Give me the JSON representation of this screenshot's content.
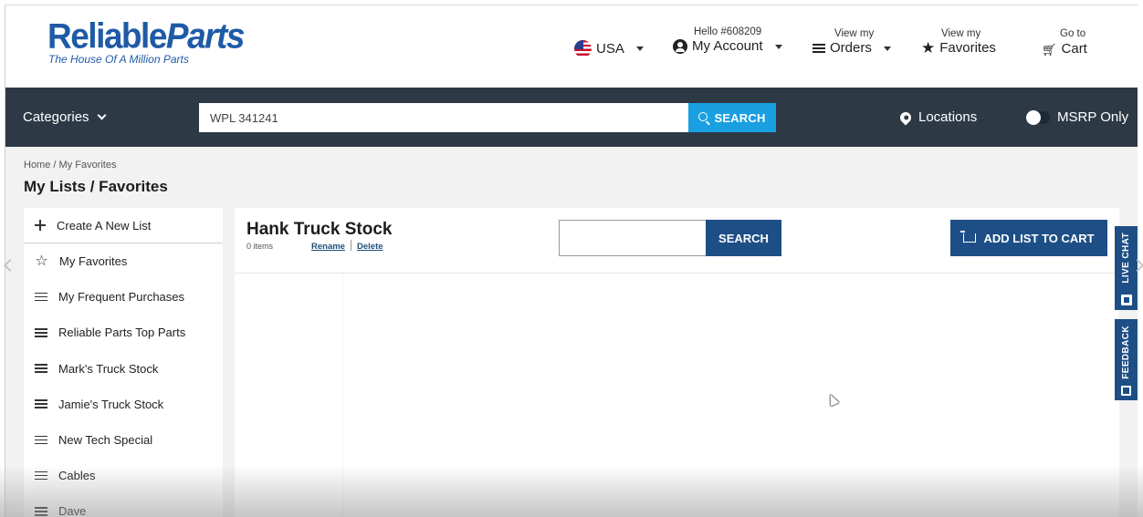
{
  "brand": {
    "name_a": "Reliable",
    "name_b": "Parts",
    "tagline": "The House Of A Million Parts",
    "color": "#1f5aa6"
  },
  "header": {
    "country": "USA",
    "account_greeting": "Hello #608209",
    "account_label": "My Account",
    "orders_small": "View my",
    "orders_label": "Orders",
    "favorites_small": "View my",
    "favorites_label": "Favorites",
    "cart_small": "Go to",
    "cart_label": "Cart"
  },
  "nav": {
    "categories_label": "Categories",
    "search_value": "WPL 341241",
    "search_button": "SEARCH",
    "locations_label": "Locations",
    "msrp_label": "MSRP Only",
    "msrp_enabled": false,
    "bg_color": "#2d3a45",
    "search_color": "#1a9fe0"
  },
  "page": {
    "breadcrumb": "Home / My Favorites",
    "title": "My Lists / Favorites"
  },
  "sidebar": {
    "create_label": "Create A New List",
    "favorites_label": "My Favorites",
    "items": [
      {
        "label": "My Frequent Purchases"
      },
      {
        "label": "Reliable Parts Top Parts"
      },
      {
        "label": "Mark's Truck Stock"
      },
      {
        "label": "Jamie's Truck Stock"
      },
      {
        "label": "New Tech Special"
      },
      {
        "label": "Cables"
      },
      {
        "label": "Dave"
      }
    ]
  },
  "list": {
    "title": "Hank Truck Stock",
    "item_count": "0 items",
    "rename_label": "Rename",
    "delete_label": "Delete",
    "search_placeholder": "",
    "search_button": "SEARCH",
    "add_to_cart_label": "ADD LIST TO CART",
    "button_color": "#1d4f86"
  },
  "side_tabs": {
    "live_chat": "LIVE CHAT",
    "feedback": "FEEDBACK"
  }
}
